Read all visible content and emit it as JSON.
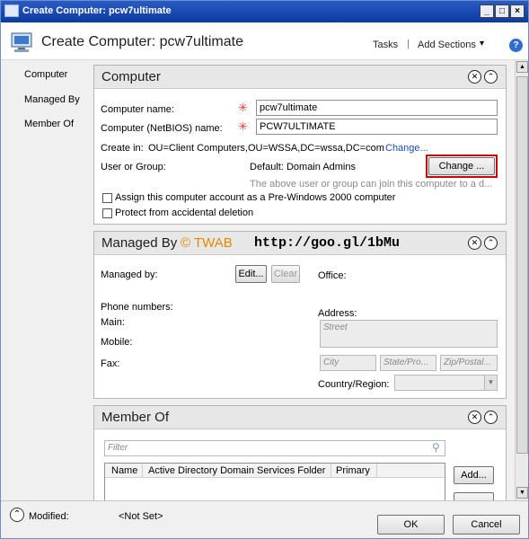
{
  "window": {
    "title": "Create Computer: pcw7ultimate"
  },
  "header": {
    "title": "Create Computer: pcw7ultimate",
    "tasks": "Tasks",
    "separator": "|",
    "add_sections": "Add Sections",
    "help": "?"
  },
  "nav": {
    "items": [
      {
        "label": "Computer"
      },
      {
        "label": "Managed By"
      },
      {
        "label": "Member Of"
      }
    ]
  },
  "computer": {
    "title": "Computer",
    "name_label": "Computer name:",
    "name_value": "pcw7ultimate",
    "netbios_label": "Computer (NetBIOS) name:",
    "netbios_value": "PCW7ULTIMATE",
    "create_in_label": "Create in:",
    "create_in_value": "OU=Client Computers,OU=WSSA,DC=wssa,DC=com",
    "change_link": "Change...",
    "user_group_label": "User or Group:",
    "user_group_value": "Default: Domain Admins",
    "change_button": "Change ...",
    "hint": "The above user or group can join this computer to a d...",
    "pre2000_label": "Assign this computer account as a Pre-Windows 2000 computer",
    "protect_label": "Protect from accidental deletion"
  },
  "managed_by": {
    "title": "Managed By",
    "watermark": "© TWAB",
    "watermark_url": "http://goo.gl/1bMu",
    "managed_by_label": "Managed by:",
    "edit_button": "Edit...",
    "clear_button": "Clear",
    "office_label": "Office:",
    "phone_label": "Phone numbers:",
    "main_label": "Main:",
    "mobile_label": "Mobile:",
    "fax_label": "Fax:",
    "address_label": "Address:",
    "street_placeholder": "Street",
    "city_placeholder": "City",
    "state_placeholder": "State/Pro...",
    "zip_placeholder": "Zip/Postal...",
    "country_label": "Country/Region:"
  },
  "member_of": {
    "title": "Member Of",
    "filter_placeholder": "Filter",
    "columns": [
      "Name",
      "Active Directory Domain Services Folder",
      "Primary"
    ],
    "add_button": "Add..."
  },
  "footer": {
    "modified_label": "Modified:",
    "modified_value": "<Not Set>",
    "ok": "OK",
    "cancel": "Cancel"
  },
  "colors": {
    "title_bar": "#0b3aa0",
    "link": "#1a50b8",
    "required": "#e33333",
    "highlight_box": "#cc0000"
  }
}
